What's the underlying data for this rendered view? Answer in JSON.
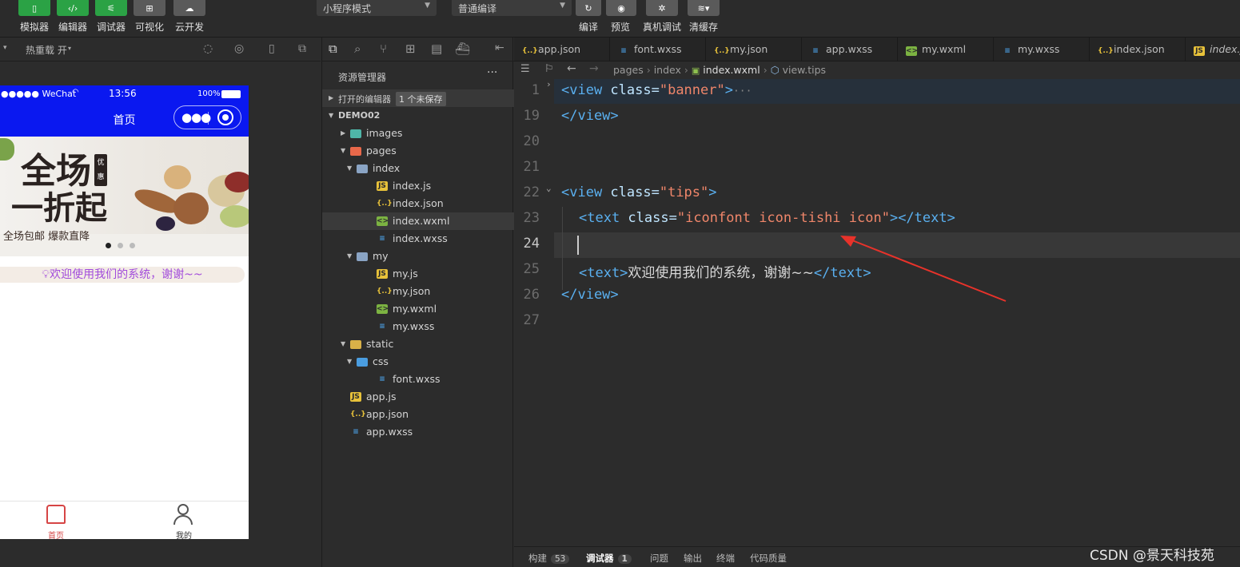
{
  "toolbar": {
    "buttons": [
      {
        "label": "模拟器",
        "icon": "phone-icon"
      },
      {
        "label": "编辑器",
        "icon": "code-icon"
      },
      {
        "label": "调试器",
        "icon": "sliders-icon"
      },
      {
        "label": "可视化",
        "icon": "layout-icon"
      },
      {
        "label": "云开发",
        "icon": "cloud-icon"
      }
    ],
    "mode_select": "小程序模式",
    "compile_select": "普通编译",
    "actions": [
      {
        "label": "编译",
        "icon": "refresh-icon"
      },
      {
        "label": "预览",
        "icon": "eye-icon"
      },
      {
        "label": "真机调试",
        "icon": "bug-icon"
      },
      {
        "label": "清缓存",
        "icon": "layers-icon"
      }
    ]
  },
  "simulator": {
    "hot_reload": "热重载 开",
    "status_bar": {
      "carrier": "●●●●● WeChat",
      "time": "13:56",
      "battery": "100%"
    },
    "nav_title": "首页",
    "banner": {
      "headline_1": "全场",
      "headline_2": "一折起",
      "seal": "优惠",
      "slogan": "全场包邮 爆款直降"
    },
    "tips_text": "欢迎使用我们的系统，谢谢~~",
    "tabbar": [
      {
        "label": "首页",
        "icon": "home-icon",
        "active": true
      },
      {
        "label": "我的",
        "icon": "user-icon",
        "active": false
      }
    ]
  },
  "explorer": {
    "title": "资源管理器",
    "open_editors": "打开的编辑器",
    "unsaved_badge": "1 个未保存",
    "project": "DEMO02",
    "tree": [
      {
        "name": "images",
        "type": "folder",
        "open": false,
        "depth": 1
      },
      {
        "name": "pages",
        "type": "folder",
        "open": true,
        "depth": 1
      },
      {
        "name": "index",
        "type": "folder",
        "open": true,
        "depth": 2
      },
      {
        "name": "index.js",
        "type": "js",
        "depth": 3
      },
      {
        "name": "index.json",
        "type": "json",
        "depth": 3
      },
      {
        "name": "index.wxml",
        "type": "wxml",
        "depth": 3,
        "selected": true
      },
      {
        "name": "index.wxss",
        "type": "wxss",
        "depth": 3
      },
      {
        "name": "my",
        "type": "folder",
        "open": true,
        "depth": 2
      },
      {
        "name": "my.js",
        "type": "js",
        "depth": 3
      },
      {
        "name": "my.json",
        "type": "json",
        "depth": 3
      },
      {
        "name": "my.wxml",
        "type": "wxml",
        "depth": 3
      },
      {
        "name": "my.wxss",
        "type": "wxss",
        "depth": 3
      },
      {
        "name": "static",
        "type": "folder",
        "open": true,
        "depth": 1
      },
      {
        "name": "css",
        "type": "folder",
        "open": true,
        "depth": 2
      },
      {
        "name": "font.wxss",
        "type": "wxss",
        "depth": 3
      },
      {
        "name": "app.js",
        "type": "js",
        "depth": 1
      },
      {
        "name": "app.json",
        "type": "json",
        "depth": 1
      },
      {
        "name": "app.wxss",
        "type": "wxss",
        "depth": 1
      }
    ]
  },
  "editor": {
    "tabs": [
      {
        "name": "app.json",
        "type": "json"
      },
      {
        "name": "font.wxss",
        "type": "wxss"
      },
      {
        "name": "my.json",
        "type": "json"
      },
      {
        "name": "app.wxss",
        "type": "wxss"
      },
      {
        "name": "my.wxml",
        "type": "wxml"
      },
      {
        "name": "my.wxss",
        "type": "wxss"
      },
      {
        "name": "index.json",
        "type": "json"
      },
      {
        "name": "index.js",
        "type": "js"
      }
    ],
    "breadcrumb": [
      "pages",
      "index",
      "index.wxml",
      "view.tips"
    ],
    "lines": [
      {
        "num": "1"
      },
      {
        "num": "19"
      },
      {
        "num": "20"
      },
      {
        "num": "21"
      },
      {
        "num": "22"
      },
      {
        "num": "23"
      },
      {
        "num": "24"
      },
      {
        "num": "25"
      },
      {
        "num": "26"
      },
      {
        "num": "27"
      }
    ],
    "code": {
      "l1_open": "<view",
      "l1_attr": " class=",
      "l1_str": "\"banner\"",
      "l1_close": ">",
      "l1_fold": "···",
      "l19": "</view>",
      "l22_open": "<view",
      "l22_attr": " class=",
      "l22_str": "\"tips\"",
      "l22_close": ">",
      "l23_open": "<text",
      "l23_attr": " class=",
      "l23_str": "\"iconfont icon-tishi icon\"",
      "l23_close": "></text>",
      "l25_open": "<text>",
      "l25_text": "欢迎使用我们的系统，谢谢~~",
      "l25_close": "</text>",
      "l26": "</view>"
    }
  },
  "statusbar": {
    "build": "构建",
    "build_count": "53",
    "debugger": "调试器",
    "debugger_count": "1",
    "problems": "问题",
    "output": "输出",
    "terminal": "终端",
    "quality": "代码质量"
  },
  "watermark": "CSDN @景天科技苑"
}
